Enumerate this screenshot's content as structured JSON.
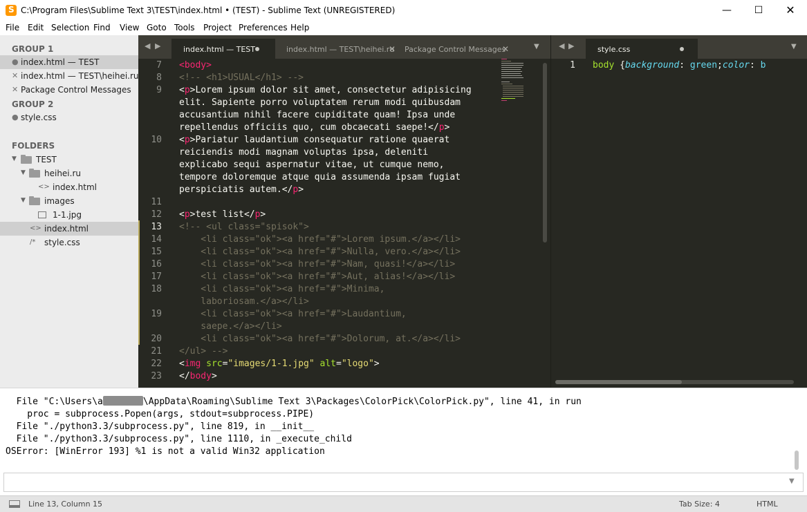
{
  "window": {
    "title": "C:\\Program Files\\Sublime Text 3\\TEST\\index.html • (TEST) - Sublime Text (UNREGISTERED)",
    "minimize": "—",
    "maximize": "☐",
    "close": "✕"
  },
  "menu": [
    "File",
    "Edit",
    "Selection",
    "Find",
    "View",
    "Goto",
    "Tools",
    "Project",
    "Preferences",
    "Help"
  ],
  "sidebar": {
    "group1": "GROUP 1",
    "group1_files": [
      "index.html — TEST",
      "index.html — TEST\\heihei.ru",
      "Package Control Messages"
    ],
    "group2": "GROUP 2",
    "group2_files": [
      "style.css"
    ],
    "folders_title": "FOLDERS",
    "tree": {
      "root": "TEST",
      "sub1": "heihei.ru",
      "sub1_file": "index.html",
      "sub2": "images",
      "sub2_file": "1-1.jpg",
      "file1": "index.html",
      "file2": "style.css"
    }
  },
  "left_tabs": [
    "index.html — TEST",
    "index.html — TEST\\heihei.ru",
    "Package Control Messages"
  ],
  "right_tabs": [
    "style.css"
  ],
  "left_line_numbers": [
    "7",
    "8",
    "9",
    "10",
    "11",
    "12",
    "13",
    "14",
    "15",
    "16",
    "17",
    "18",
    "19",
    "20",
    "21",
    "22",
    "23"
  ],
  "right_line_numbers": [
    "1"
  ],
  "left_code": {
    "l7_tag": "<body>",
    "l8_cmt": "<!-- <h1>USUAL</h1> -->",
    "l9a_open": "<p>",
    "l9a_text": "Lorem ipsum dolor sit amet, consectetur adipisicing",
    "l9b_text": "elit. Sapiente porro voluptatem rerum modi quibusdam",
    "l9c_text": "accusantium nihil facere cupiditate quam! Ipsa unde",
    "l9d_text": "repellendus officiis quo, cum obcaecati saepe!",
    "l9d_close": "</p>",
    "l10a_open": "<p>",
    "l10a_text": "Pariatur laudantium consequatur ratione quaerat",
    "l10b_text": "reiciendis modi magnam voluptas ipsa, deleniti",
    "l10c_text": "explicabo sequi aspernatur vitae, ut cumque nemo,",
    "l10d_text": "tempore doloremque atque quia assumenda ipsam fugiat",
    "l10e_text": "perspiciatis autem.",
    "l10e_close": "</p>",
    "l12_open": "<p>",
    "l12_text": "test list",
    "l12_close": "</p>",
    "l13": "<!-- <ul class=\"spisok\">",
    "l14": "    <li class=\"ok\"><a href=\"#\">Lorem ipsum.</a></li>",
    "l15": "    <li class=\"ok\"><a href=\"#\">Nulla, vero.</a></li>",
    "l16": "    <li class=\"ok\"><a href=\"#\">Nam, quasi!</a></li>",
    "l17": "    <li class=\"ok\"><a href=\"#\">Aut, alias!</a></li>",
    "l18a": "    <li class=\"ok\"><a href=\"#\">Minima,",
    "l18b": "    laboriosam.</a></li>",
    "l19a": "    <li class=\"ok\"><a href=\"#\">Laudantium,",
    "l19b": "    saepe.</a></li>",
    "l20": "    <li class=\"ok\"><a href=\"#\">Dolorum, at.</a></li>",
    "l21": "</ul> -->",
    "l22_tag_open": "<img ",
    "l22_attr1": "src",
    "l22_eq1": "=",
    "l22_str1": "\"images/1-1.jpg\"",
    "l22_attr2": " alt",
    "l22_eq2": "=",
    "l22_str2": "\"logo\"",
    "l22_tag_close": ">",
    "l23_tag": "</body>"
  },
  "right_code": {
    "selector": "body",
    "brace": " {",
    "prop1": "background",
    "colon1": ": ",
    "val1": "green",
    "semi": ";",
    "prop2": "color",
    "colon2": ": ",
    "val2": "b"
  },
  "console": {
    "l1_a": "  File \"C:\\Users\\a",
    "l1_b": "\\AppData\\Roaming\\Sublime Text 3\\Packages\\ColorPick\\ColorPick.py\", line 41, in run",
    "l2": "    proc = subprocess.Popen(args, stdout=subprocess.PIPE)",
    "l3": "  File \"./python3.3/subprocess.py\", line 819, in __init__",
    "l4": "  File \"./python3.3/subprocess.py\", line 1110, in _execute_child",
    "l5": "OSError: [WinError 193] %1 is not a valid Win32 application"
  },
  "status": {
    "position": "Line 13, Column 15",
    "tab_size": "Tab Size: 4",
    "syntax": "HTML"
  },
  "colors": {
    "editor_bg": "#272822",
    "tag": "#f92672",
    "attr": "#a6e22e",
    "string": "#e6db74",
    "comment": "#75715e",
    "keyword": "#66d9ef"
  }
}
